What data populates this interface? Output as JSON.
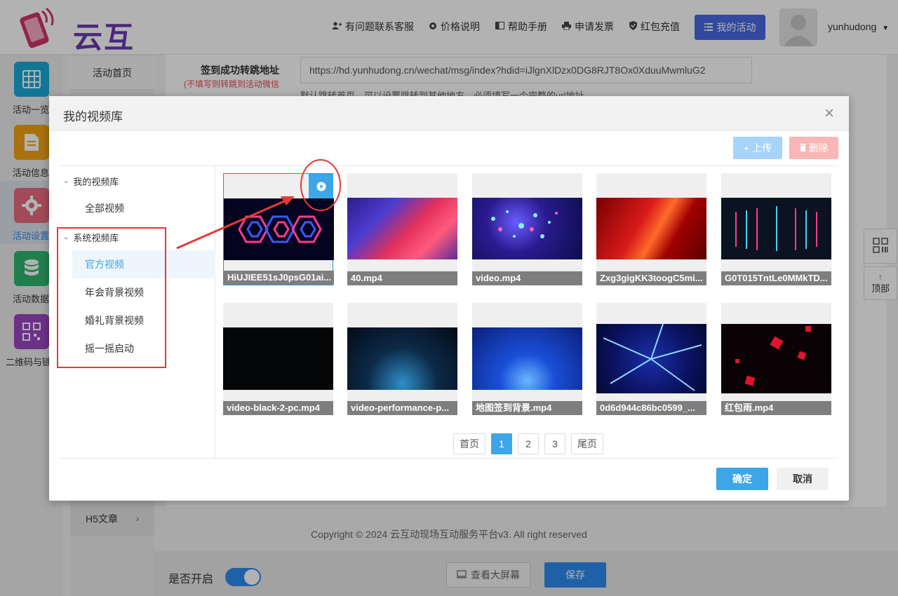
{
  "header": {
    "logo_text": "云互动",
    "nav": [
      {
        "label": "有问题联系客服",
        "icon": "user-plus-icon"
      },
      {
        "label": "价格说明",
        "icon": "gear-icon"
      },
      {
        "label": "帮助手册",
        "icon": "book-icon"
      },
      {
        "label": "申请发票",
        "icon": "print-icon"
      },
      {
        "label": "红包充值",
        "icon": "shield-check-icon"
      }
    ],
    "my_activity_label": "我的活动",
    "username": "yunhudong"
  },
  "leftnav": [
    {
      "label": "活动一览",
      "icon": "grid-icon",
      "color": "#1ba9d8"
    },
    {
      "label": "活动信息",
      "icon": "document-icon",
      "color": "#f3a316"
    },
    {
      "label": "活动设置",
      "icon": "gear-icon",
      "color": "#e86b7f"
    },
    {
      "label": "活动数据",
      "icon": "database-icon",
      "color": "#2fb66e"
    },
    {
      "label": "二维码与链接",
      "icon": "qrcode-icon",
      "color": "#9b45c4"
    }
  ],
  "subnav": {
    "home_label": "活动首页",
    "h5_label": "H5文章"
  },
  "form": {
    "label": "签到成功转跳地址",
    "hint": "(不填写则转跳到活动微信",
    "url_value": "https://hd.yunhudong.cn/wechat/msg/index?hdid=iJlgnXlDzx0DG8RJT8Ox0XduuMwmluG2",
    "help_text": "默认跳转首页，可以设置跳转到其他地方，必须填写一个完整的url地址"
  },
  "footer": {
    "copyright": "Copyright © 2024 云互动现场互动服务平台v3. All right reserved",
    "open_label": "是否开启",
    "bigscreen_label": "查看大屏幕",
    "save_label": "保存"
  },
  "float": {
    "top_label": "顶部"
  },
  "modal": {
    "title": "我的视频库",
    "upload_label": "上传",
    "delete_label": "删除",
    "tree": {
      "group1": "我的视频库",
      "group1_items": [
        "全部视频"
      ],
      "group2": "系统视频库",
      "group2_items": [
        "官方视频",
        "年会背景视频",
        "婚礼背景视频",
        "摇一摇启动"
      ]
    },
    "videos": [
      "HiUJIEE51sJ0psG01ai...",
      "40.mp4",
      "video.mp4",
      "Zxg3gigKK3toogC5mi...",
      "G0T015TntLe0MMkTD...",
      "video-black-2-pc.mp4",
      "video-performance-p...",
      "地图签到背景.mp4",
      "0d6d944c86bc0599_...",
      "红包雨.mp4"
    ],
    "pager": {
      "first": "首页",
      "pages": [
        "1",
        "2",
        "3"
      ],
      "current": "1",
      "last": "尾页"
    },
    "ok_label": "确定",
    "cancel_label": "取消"
  }
}
